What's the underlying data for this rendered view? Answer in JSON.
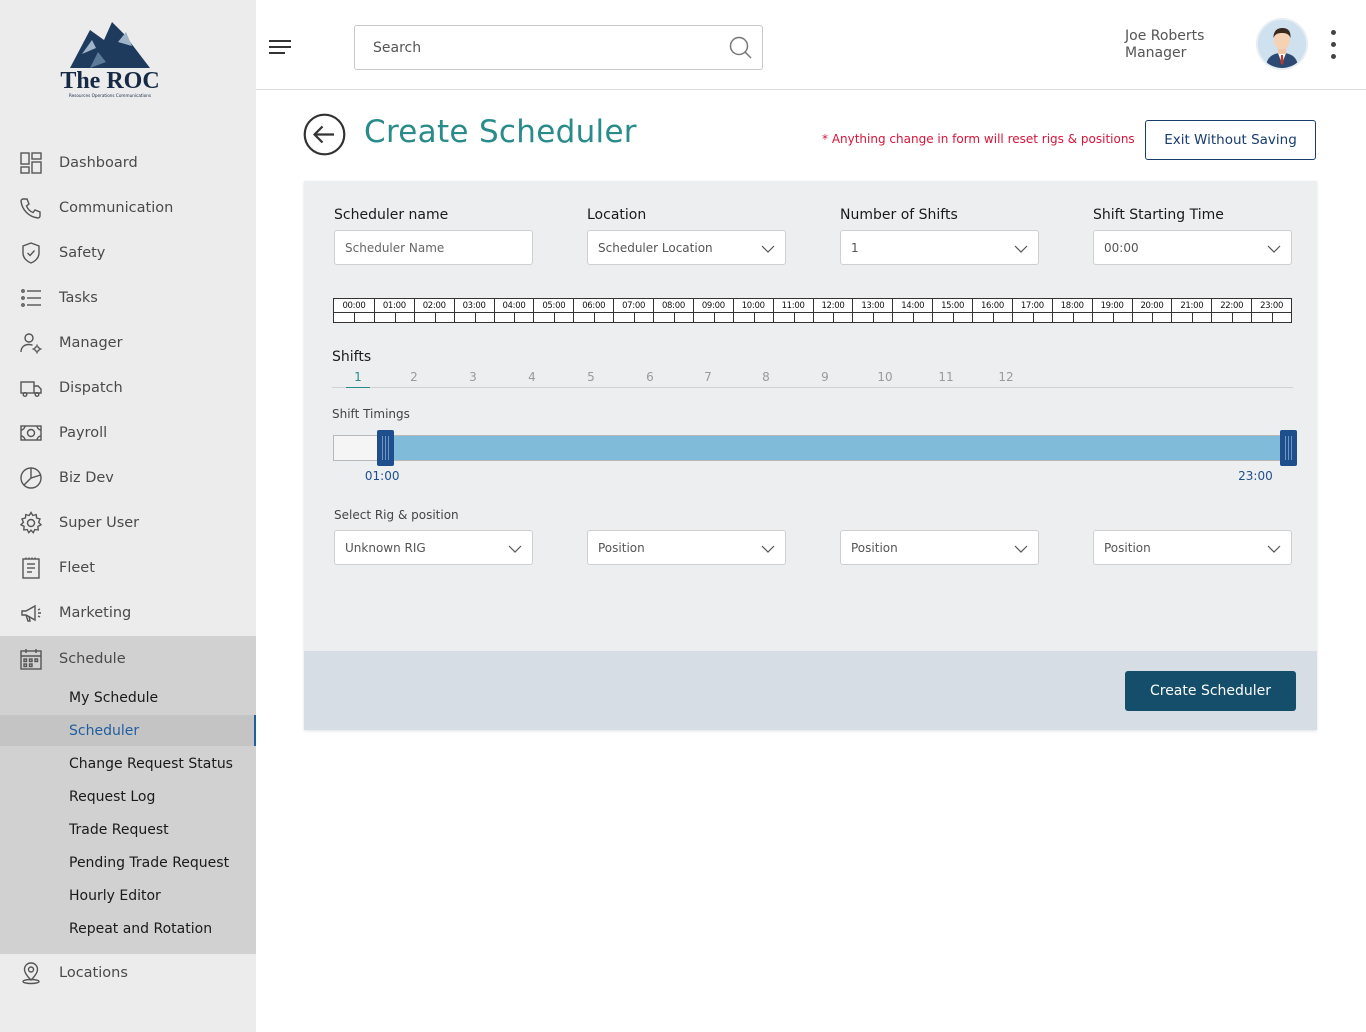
{
  "app": {
    "logo_text": "The ROC",
    "logo_subtext": "Resources Operations Communications"
  },
  "sidebar": {
    "items": [
      {
        "label": "Dashboard",
        "icon": "dashboard-icon"
      },
      {
        "label": "Communication",
        "icon": "phone-icon"
      },
      {
        "label": "Safety",
        "icon": "shield-icon"
      },
      {
        "label": "Tasks",
        "icon": "list-icon"
      },
      {
        "label": "Manager",
        "icon": "user-gear-icon"
      },
      {
        "label": "Dispatch",
        "icon": "truck-icon"
      },
      {
        "label": "Payroll",
        "icon": "money-icon"
      },
      {
        "label": "Biz Dev",
        "icon": "pie-chart-icon"
      },
      {
        "label": "Super User",
        "icon": "gear-icon"
      },
      {
        "label": "Fleet",
        "icon": "clipboard-icon"
      },
      {
        "label": "Marketing",
        "icon": "megaphone-icon"
      },
      {
        "label": "Schedule",
        "icon": "calendar-icon"
      },
      {
        "label": "Locations",
        "icon": "location-pin-icon"
      }
    ],
    "schedule_sub": [
      {
        "label": "My Schedule"
      },
      {
        "label": "Scheduler",
        "active": true
      },
      {
        "label": "Change Request Status"
      },
      {
        "label": "Request Log"
      },
      {
        "label": "Trade Request"
      },
      {
        "label": "Pending Trade Request"
      },
      {
        "label": "Hourly Editor"
      },
      {
        "label": "Repeat and Rotation"
      }
    ]
  },
  "header": {
    "search_placeholder": "Search",
    "user_name": "Joe Roberts",
    "user_role": "Manager"
  },
  "page": {
    "title": "Create Scheduler",
    "warning": "* Anything change in form will reset rigs & positions",
    "exit_label": "Exit Without Saving"
  },
  "form": {
    "scheduler_name": {
      "label": "Scheduler name",
      "placeholder": "Scheduler Name"
    },
    "location": {
      "label": "Location",
      "value": "Scheduler Location"
    },
    "num_shifts": {
      "label": "Number of Shifts",
      "value": "1"
    },
    "start_time": {
      "label": "Shift Starting Time",
      "value": "00:00"
    },
    "timeline_hours": [
      "00:00",
      "01:00",
      "02:00",
      "03:00",
      "04:00",
      "05:00",
      "06:00",
      "07:00",
      "08:00",
      "09:00",
      "10:00",
      "11:00",
      "12:00",
      "13:00",
      "14:00",
      "15:00",
      "16:00",
      "17:00",
      "18:00",
      "19:00",
      "20:00",
      "21:00",
      "22:00",
      "23:00"
    ],
    "shifts_label": "Shifts",
    "shift_tabs": [
      "1",
      "2",
      "3",
      "4",
      "5",
      "6",
      "7",
      "8",
      "9",
      "10",
      "11",
      "12"
    ],
    "active_shift": "1",
    "timings_label": "Shift Timings",
    "timing_start": "01:00",
    "timing_end": "23:00",
    "timing_start_hours": 1,
    "timing_end_hours": 23,
    "rig_label": "Select Rig & position",
    "rig_value": "Unknown RIG",
    "positions": [
      "Position",
      "Position",
      "Position"
    ],
    "create_label": "Create Scheduler"
  },
  "colors": {
    "accent_teal": "#2a8b8b",
    "primary_navy": "#144e6b",
    "warning_red": "#d8143a",
    "slider_fill": "#80bcd9",
    "handle": "#1f4e8c"
  }
}
